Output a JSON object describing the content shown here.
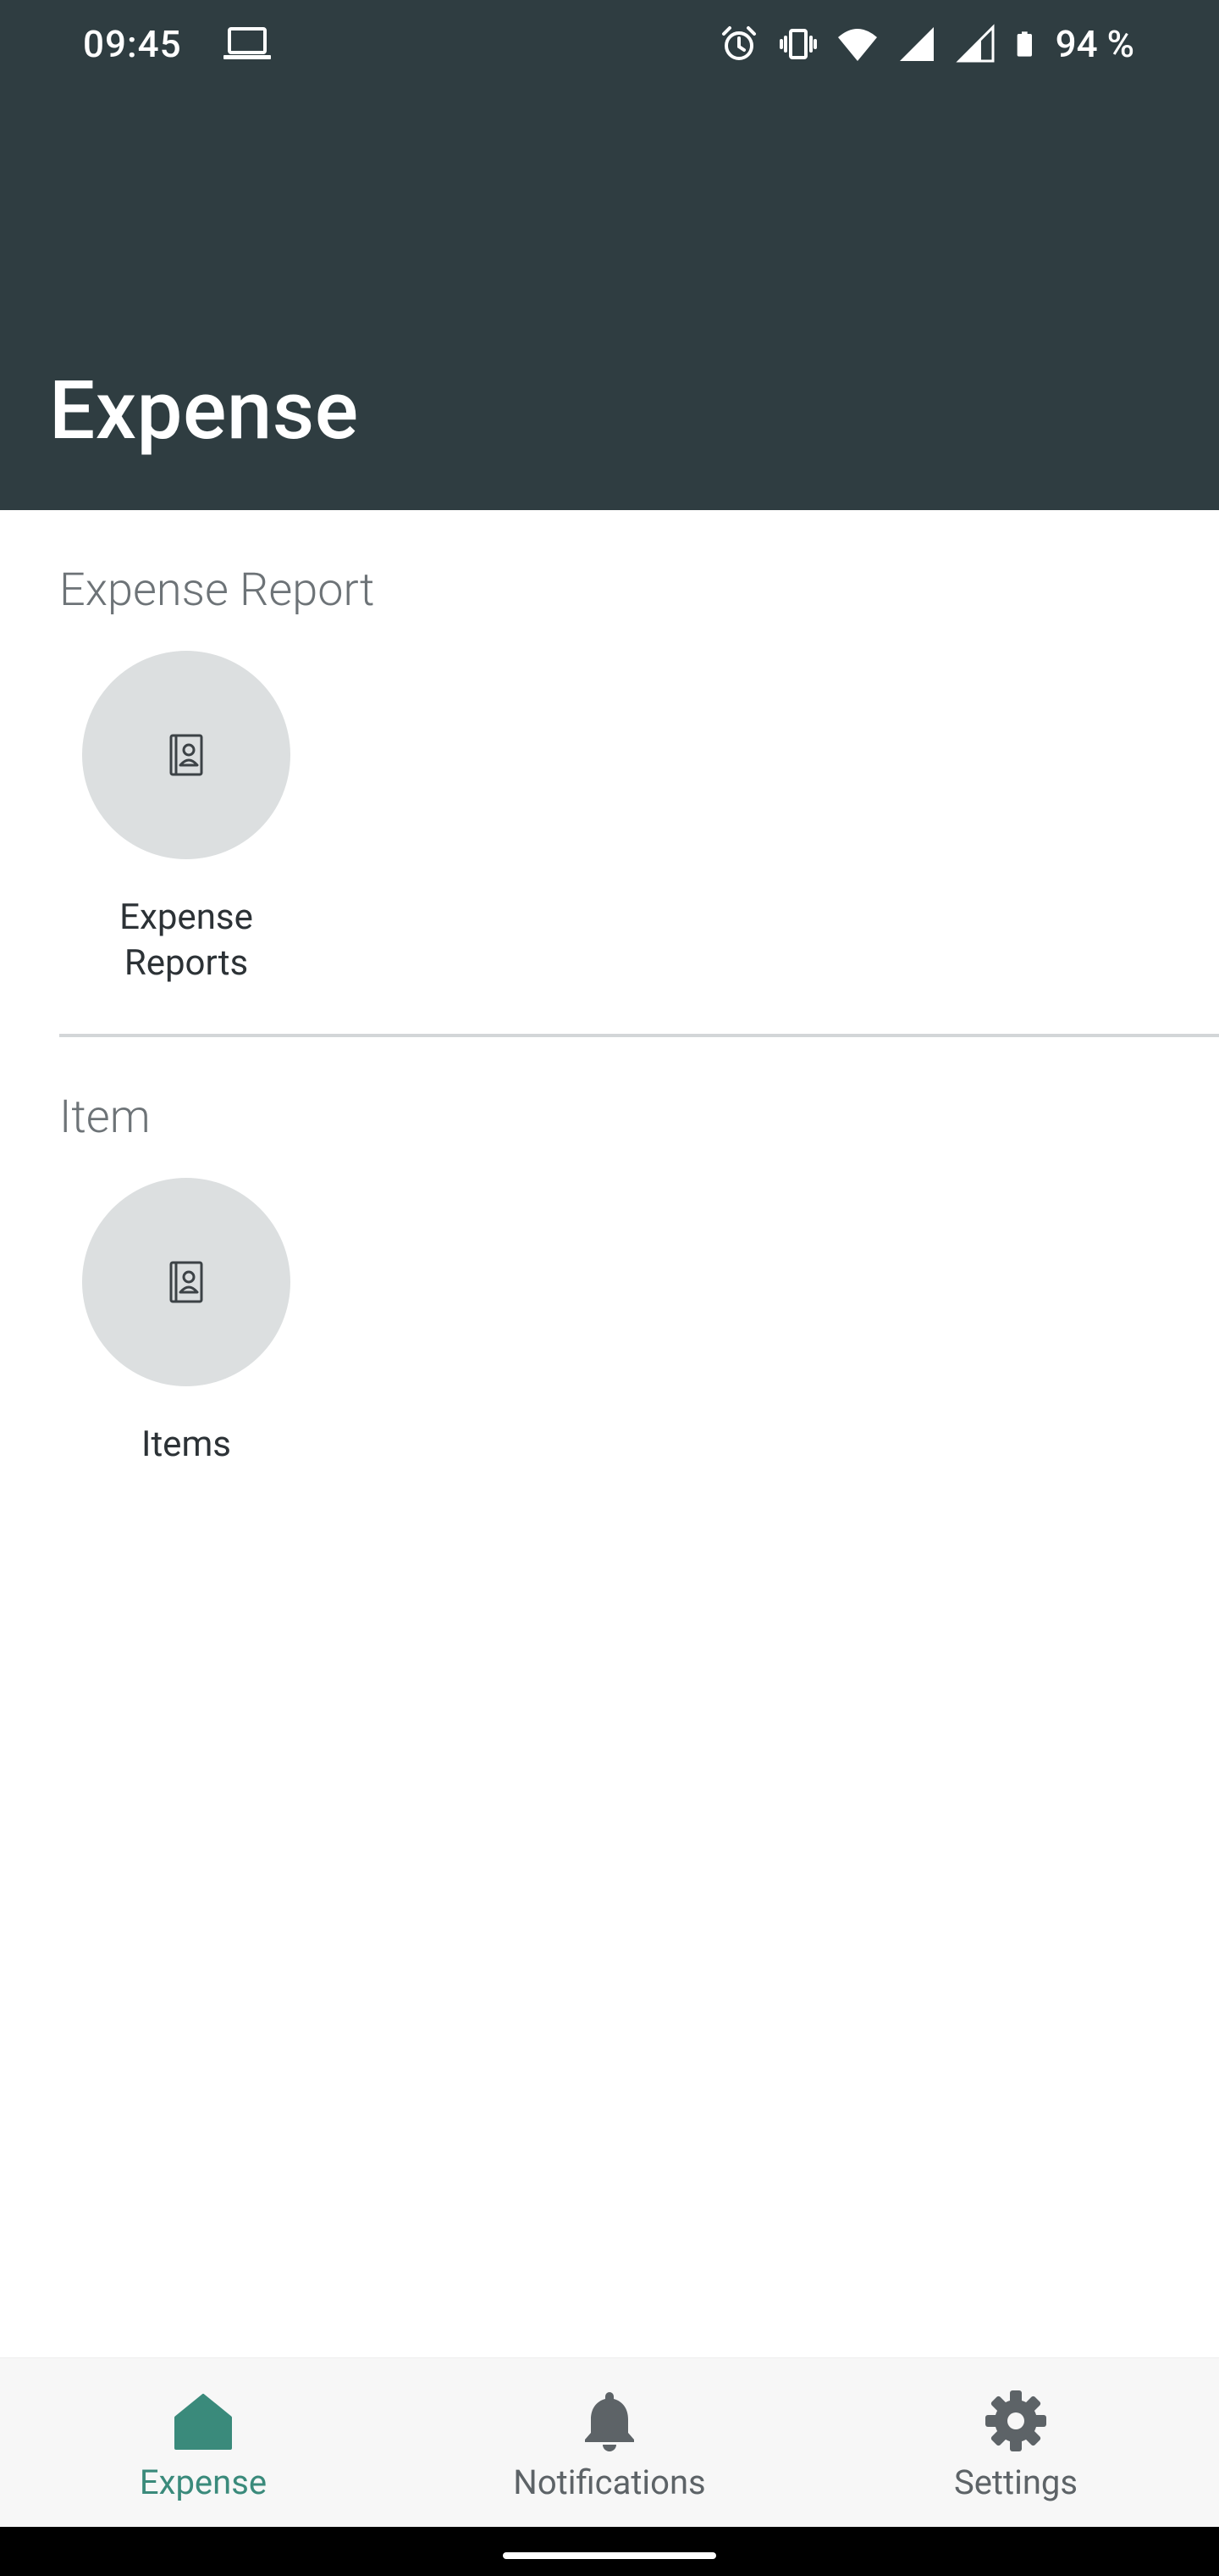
{
  "status_bar": {
    "time": "09:45",
    "battery_percent": "94 %",
    "icons": [
      "laptop-icon",
      "alarm-icon",
      "vibrate-icon",
      "wifi-icon",
      "signal-icon",
      "signal-icon",
      "battery-icon"
    ]
  },
  "header": {
    "title": "Expense",
    "background_color": "#2f3d41"
  },
  "sections": [
    {
      "title": "Expense Report",
      "tiles": [
        {
          "label": "Expense\nReports",
          "icon": "contact-book-icon"
        }
      ]
    },
    {
      "title": "Item",
      "tiles": [
        {
          "label": "Items",
          "icon": "contact-book-icon"
        }
      ]
    }
  ],
  "bottom_nav": {
    "items": [
      {
        "label": "Expense",
        "icon": "home-icon",
        "active": true
      },
      {
        "label": "Notifications",
        "icon": "bell-icon",
        "active": false
      },
      {
        "label": "Settings",
        "icon": "gear-icon",
        "active": false
      }
    ],
    "active_color": "#3a8a7b",
    "inactive_color": "#5d6367"
  }
}
